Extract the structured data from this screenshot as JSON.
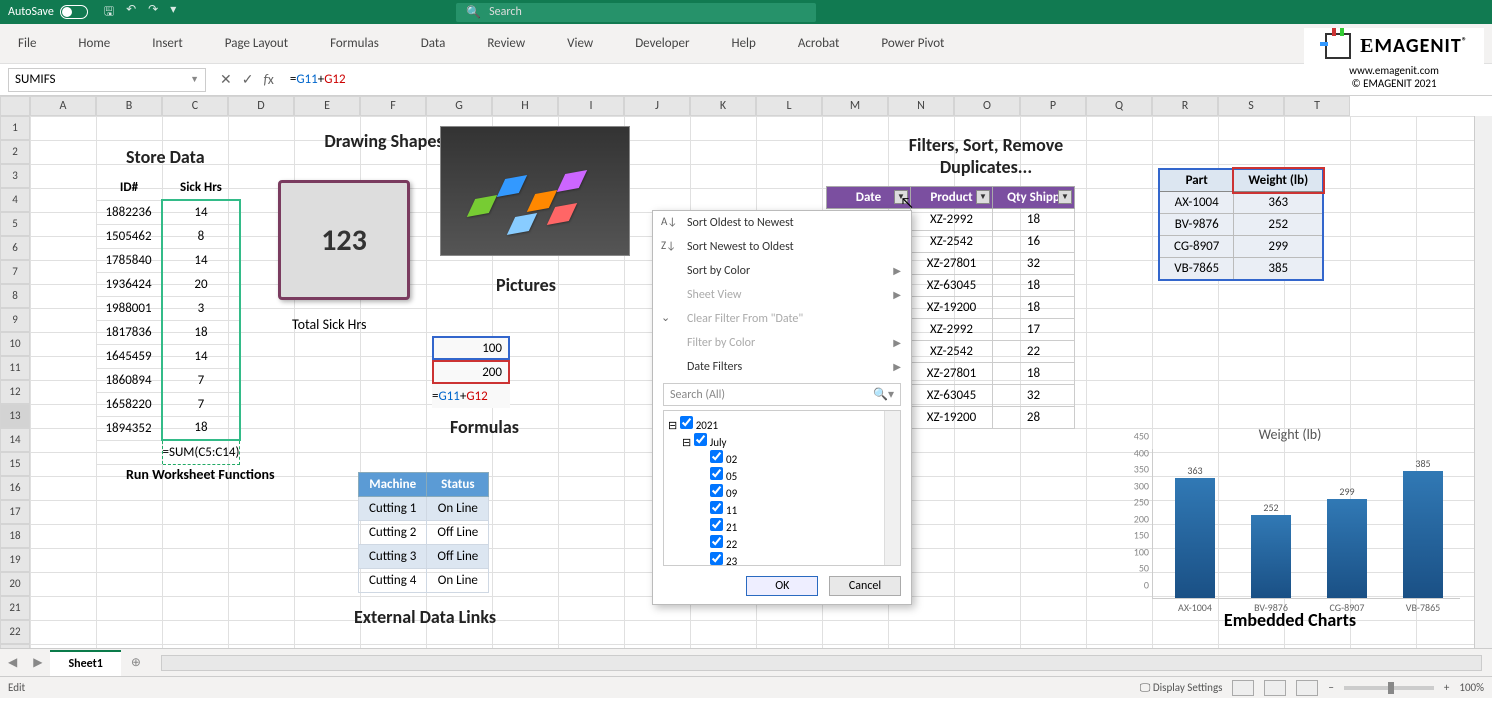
{
  "titlebar": {
    "autosave_label": "AutoSave",
    "autosave_state": "Off",
    "search_placeholder": "Search"
  },
  "ribbon_tabs": [
    "File",
    "Home",
    "Insert",
    "Page Layout",
    "Formulas",
    "Data",
    "Review",
    "View",
    "Developer",
    "Help",
    "Acrobat",
    "Power Pivot"
  ],
  "formula_bar": {
    "namebox": "SUMIFS",
    "formula_prefix": "=",
    "formula_ref1": "G11",
    "formula_op": "+",
    "formula_ref2": "G12"
  },
  "store": {
    "title": "Store Data",
    "hdr_id": "ID#",
    "hdr_sick": "Sick Hrs",
    "rows": [
      {
        "id": "1882236",
        "hrs": "14"
      },
      {
        "id": "1505462",
        "hrs": "8"
      },
      {
        "id": "1785840",
        "hrs": "14"
      },
      {
        "id": "1936424",
        "hrs": "20"
      },
      {
        "id": "1988001",
        "hrs": "3"
      },
      {
        "id": "1817836",
        "hrs": "18"
      },
      {
        "id": "1645459",
        "hrs": "14"
      },
      {
        "id": "1860894",
        "hrs": "7"
      },
      {
        "id": "1658220",
        "hrs": "7"
      },
      {
        "id": "1894352",
        "hrs": "18"
      }
    ],
    "sum_formula": "=SUM(C5:C14)",
    "caption": "Run Worksheet Functions"
  },
  "shape": {
    "title": "Drawing Shapes",
    "value": "123",
    "caption": "Total Sick Hrs"
  },
  "picture": {
    "title": "Pictures"
  },
  "formulas": {
    "v1": "100",
    "v2": "200",
    "expr_prefix": "=",
    "expr_r1": "G11",
    "expr_op": "+",
    "expr_r2": "G12",
    "caption": "Formulas"
  },
  "machine": {
    "hdr_m": "Machine",
    "hdr_s": "Status",
    "rows": [
      {
        "m": "Cutting 1",
        "s": "On Line"
      },
      {
        "m": "Cutting 2",
        "s": "Off Line"
      },
      {
        "m": "Cutting 3",
        "s": "Off Line"
      },
      {
        "m": "Cutting 4",
        "s": "On Line"
      }
    ],
    "caption": "External Data Links"
  },
  "filter_menu": {
    "sort_asc": "Sort Oldest to Newest",
    "sort_desc": "Sort Newest to Oldest",
    "sort_color": "Sort by Color",
    "sheet_view": "Sheet View",
    "clear": "Clear Filter From \"Date\"",
    "filter_color": "Filter by Color",
    "date_filters": "Date Filters",
    "search_ph": "Search (All)",
    "tree_year": "2021",
    "tree_month": "July",
    "tree_days": [
      "02",
      "05",
      "09",
      "11",
      "21",
      "22",
      "23"
    ],
    "ok": "OK",
    "cancel": "Cancel"
  },
  "filter_table": {
    "title": "Filters, Sort, Remove Duplicates...",
    "hdr_date": "Date",
    "hdr_prod": "Product",
    "hdr_qty": "Qty Shipp",
    "rows": [
      {
        "p": "XZ-2992",
        "q": "18"
      },
      {
        "p": "XZ-2542",
        "q": "16"
      },
      {
        "p": "XZ-27801",
        "q": "32"
      },
      {
        "p": "XZ-63045",
        "q": "18"
      },
      {
        "p": "XZ-19200",
        "q": "18"
      },
      {
        "p": "XZ-2992",
        "q": "17"
      },
      {
        "p": "XZ-2542",
        "q": "22"
      },
      {
        "p": "XZ-27801",
        "q": "18"
      },
      {
        "p": "XZ-63045",
        "q": "32"
      },
      {
        "p": "XZ-19200",
        "q": "28"
      }
    ]
  },
  "parts": {
    "hdr_p": "Part",
    "hdr_w": "Weight (lb)",
    "rows": [
      {
        "p": "AX-1004",
        "w": "363"
      },
      {
        "p": "BV-9876",
        "w": "252"
      },
      {
        "p": "CG-8907",
        "w": "299"
      },
      {
        "p": "VB-7865",
        "w": "385"
      }
    ]
  },
  "chart_data": {
    "type": "bar",
    "title": "Weight (lb)",
    "caption": "Embedded Charts",
    "categories": [
      "AX-1004",
      "BV-9876",
      "CG-8907",
      "VB-7865"
    ],
    "values": [
      363,
      252,
      299,
      385
    ],
    "ylim": [
      0,
      450
    ],
    "ytick_step": 50,
    "xlabel": "",
    "ylabel": ""
  },
  "sheettabs": {
    "sheet1": "Sheet1"
  },
  "statusbar": {
    "mode": "Edit",
    "display": "Display Settings",
    "zoom": "100%"
  },
  "logo": {
    "name": "EMAGENIT",
    "url": "www.emagenit.com",
    "copy": "© EMAGENIT  2021"
  }
}
